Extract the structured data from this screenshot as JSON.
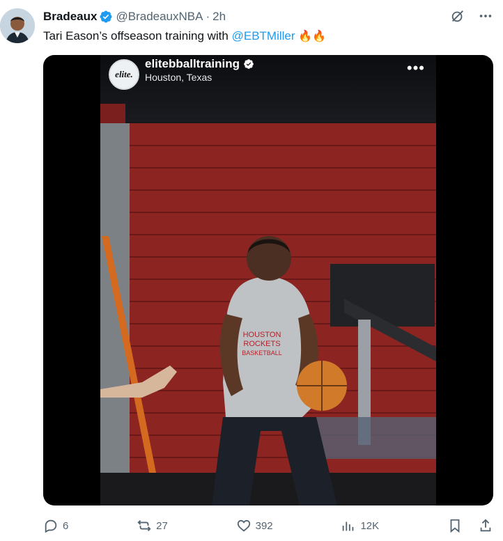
{
  "tweet": {
    "display_name": "Bradeaux",
    "handle": "@BradeauxNBA",
    "separator": "·",
    "time": "2h",
    "text_prefix": "Tari Eason’s offseason training with ",
    "mention": "@EBTMiller",
    "emojis": "🔥🔥"
  },
  "media": {
    "account_name": "elitebballtraining",
    "location": "Houston, Texas",
    "avatar_text": "elite.",
    "jersey_text": "HOUSTON ROCKETS BASKETBALL"
  },
  "actions": {
    "replies": "6",
    "reposts": "27",
    "likes": "392",
    "views": "12K"
  },
  "colors": {
    "accent": "#1d9bf0",
    "text": "#0f1419",
    "secondary": "#536471"
  },
  "icons": [
    "verified-badge-icon",
    "grok-icon",
    "more-icon",
    "reply-icon",
    "repost-icon",
    "like-icon",
    "views-icon",
    "bookmark-icon",
    "share-icon"
  ]
}
